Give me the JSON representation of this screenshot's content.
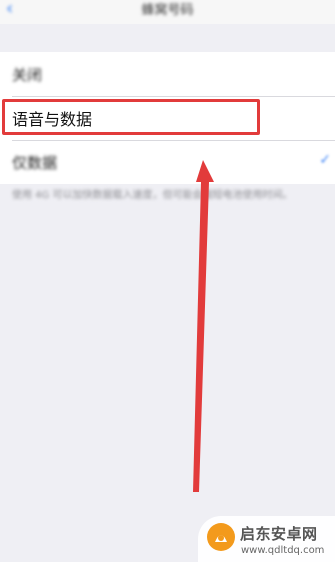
{
  "navbar": {
    "back_glyph": "‹",
    "title": "蜂窝号码"
  },
  "settings": {
    "rows": [
      {
        "label": "关闭"
      },
      {
        "label": "语音与数据"
      },
      {
        "label": "仅数据"
      }
    ],
    "footnote": "使用 4G 可以加快数据载入速度，但可能会缩短电池使用时间。"
  },
  "watermark": {
    "name": "启东安卓网",
    "url": "www.qdltdq.com"
  },
  "colors": {
    "highlight": "#e23b3b",
    "arrow": "#e23b3b",
    "accent": "#3b82f6"
  }
}
